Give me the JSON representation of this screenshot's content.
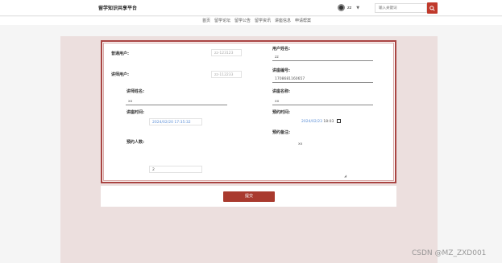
{
  "header": {
    "logo": "留学知识共享平台",
    "user_name": "zz",
    "caret": "▼",
    "search_placeholder": "输入关键词"
  },
  "nav": {
    "items": [
      "首页",
      "留学论坛",
      "留学公告",
      "留学资讯",
      "讲座信息",
      "申请帮案"
    ]
  },
  "form": {
    "normal_user_label": "普通用户:",
    "normal_user_value": "zz-123123",
    "user_name_label": "用户姓名:",
    "user_name_value": "zz",
    "lecturer_user_label": "讲师用户:",
    "lecturer_user_value": "zz-112233",
    "lecture_no_label": "讲座编号:",
    "lecture_no_value": "1708681160657",
    "lecturer_name_label": "讲师姓名:",
    "lecturer_name_value": "xx",
    "lecture_name_label": "讲座名称:",
    "lecture_name_value": "xx",
    "lecture_time_label": "讲座时间:",
    "lecture_time_value": "2024/02/20 17:35:32",
    "booking_time_label": "预约时间:",
    "booking_date_value": "2024/02/23",
    "booking_clock_value": "18:03",
    "booking_note_label": "预约备注:",
    "booking_note_value": "xx",
    "booking_count_label": "预约人数:",
    "booking_count_value": "2"
  },
  "submit_label": "提交",
  "watermark": "CSDN @MZ_ZXD001"
}
